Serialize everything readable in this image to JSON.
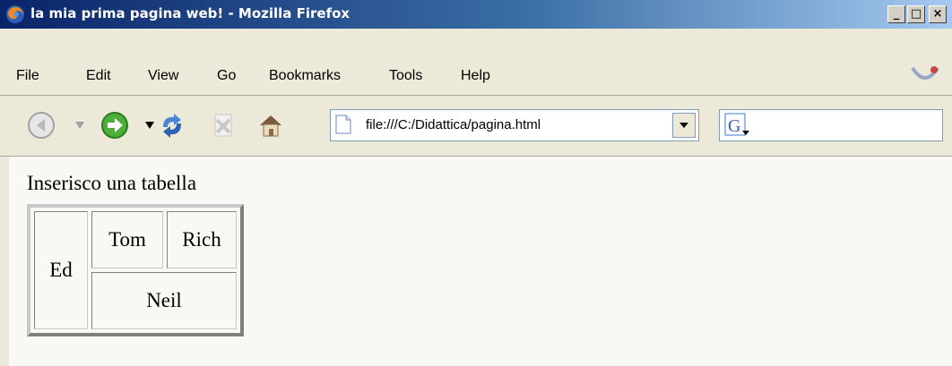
{
  "window": {
    "title": "la mia prima pagina web! - Mozilla Firefox",
    "caption_buttons": {
      "minimize": "_",
      "maximize": "□",
      "close": "×"
    }
  },
  "menu": {
    "items": [
      "File",
      "Edit",
      "View",
      "Go",
      "Bookmarks",
      "Tools",
      "Help"
    ]
  },
  "toolbar": {
    "address": "file:///C:/Didattica/pagina.html",
    "icons": [
      "back-icon",
      "forward-icon",
      "reload-icon",
      "stop-icon",
      "home-icon",
      "page-icon",
      "google-icon"
    ]
  },
  "page": {
    "intro": "Inserisco una tabella",
    "table": {
      "left_cell": "Ed",
      "top_row": [
        "Tom",
        "Rich"
      ],
      "bottom_cell": "Neil"
    }
  },
  "colors": {
    "titlebar_start": "#0a246a",
    "titlebar_end": "#a6caf0",
    "chrome": "#ece9d8",
    "content_bg": "#f8f8f4"
  }
}
